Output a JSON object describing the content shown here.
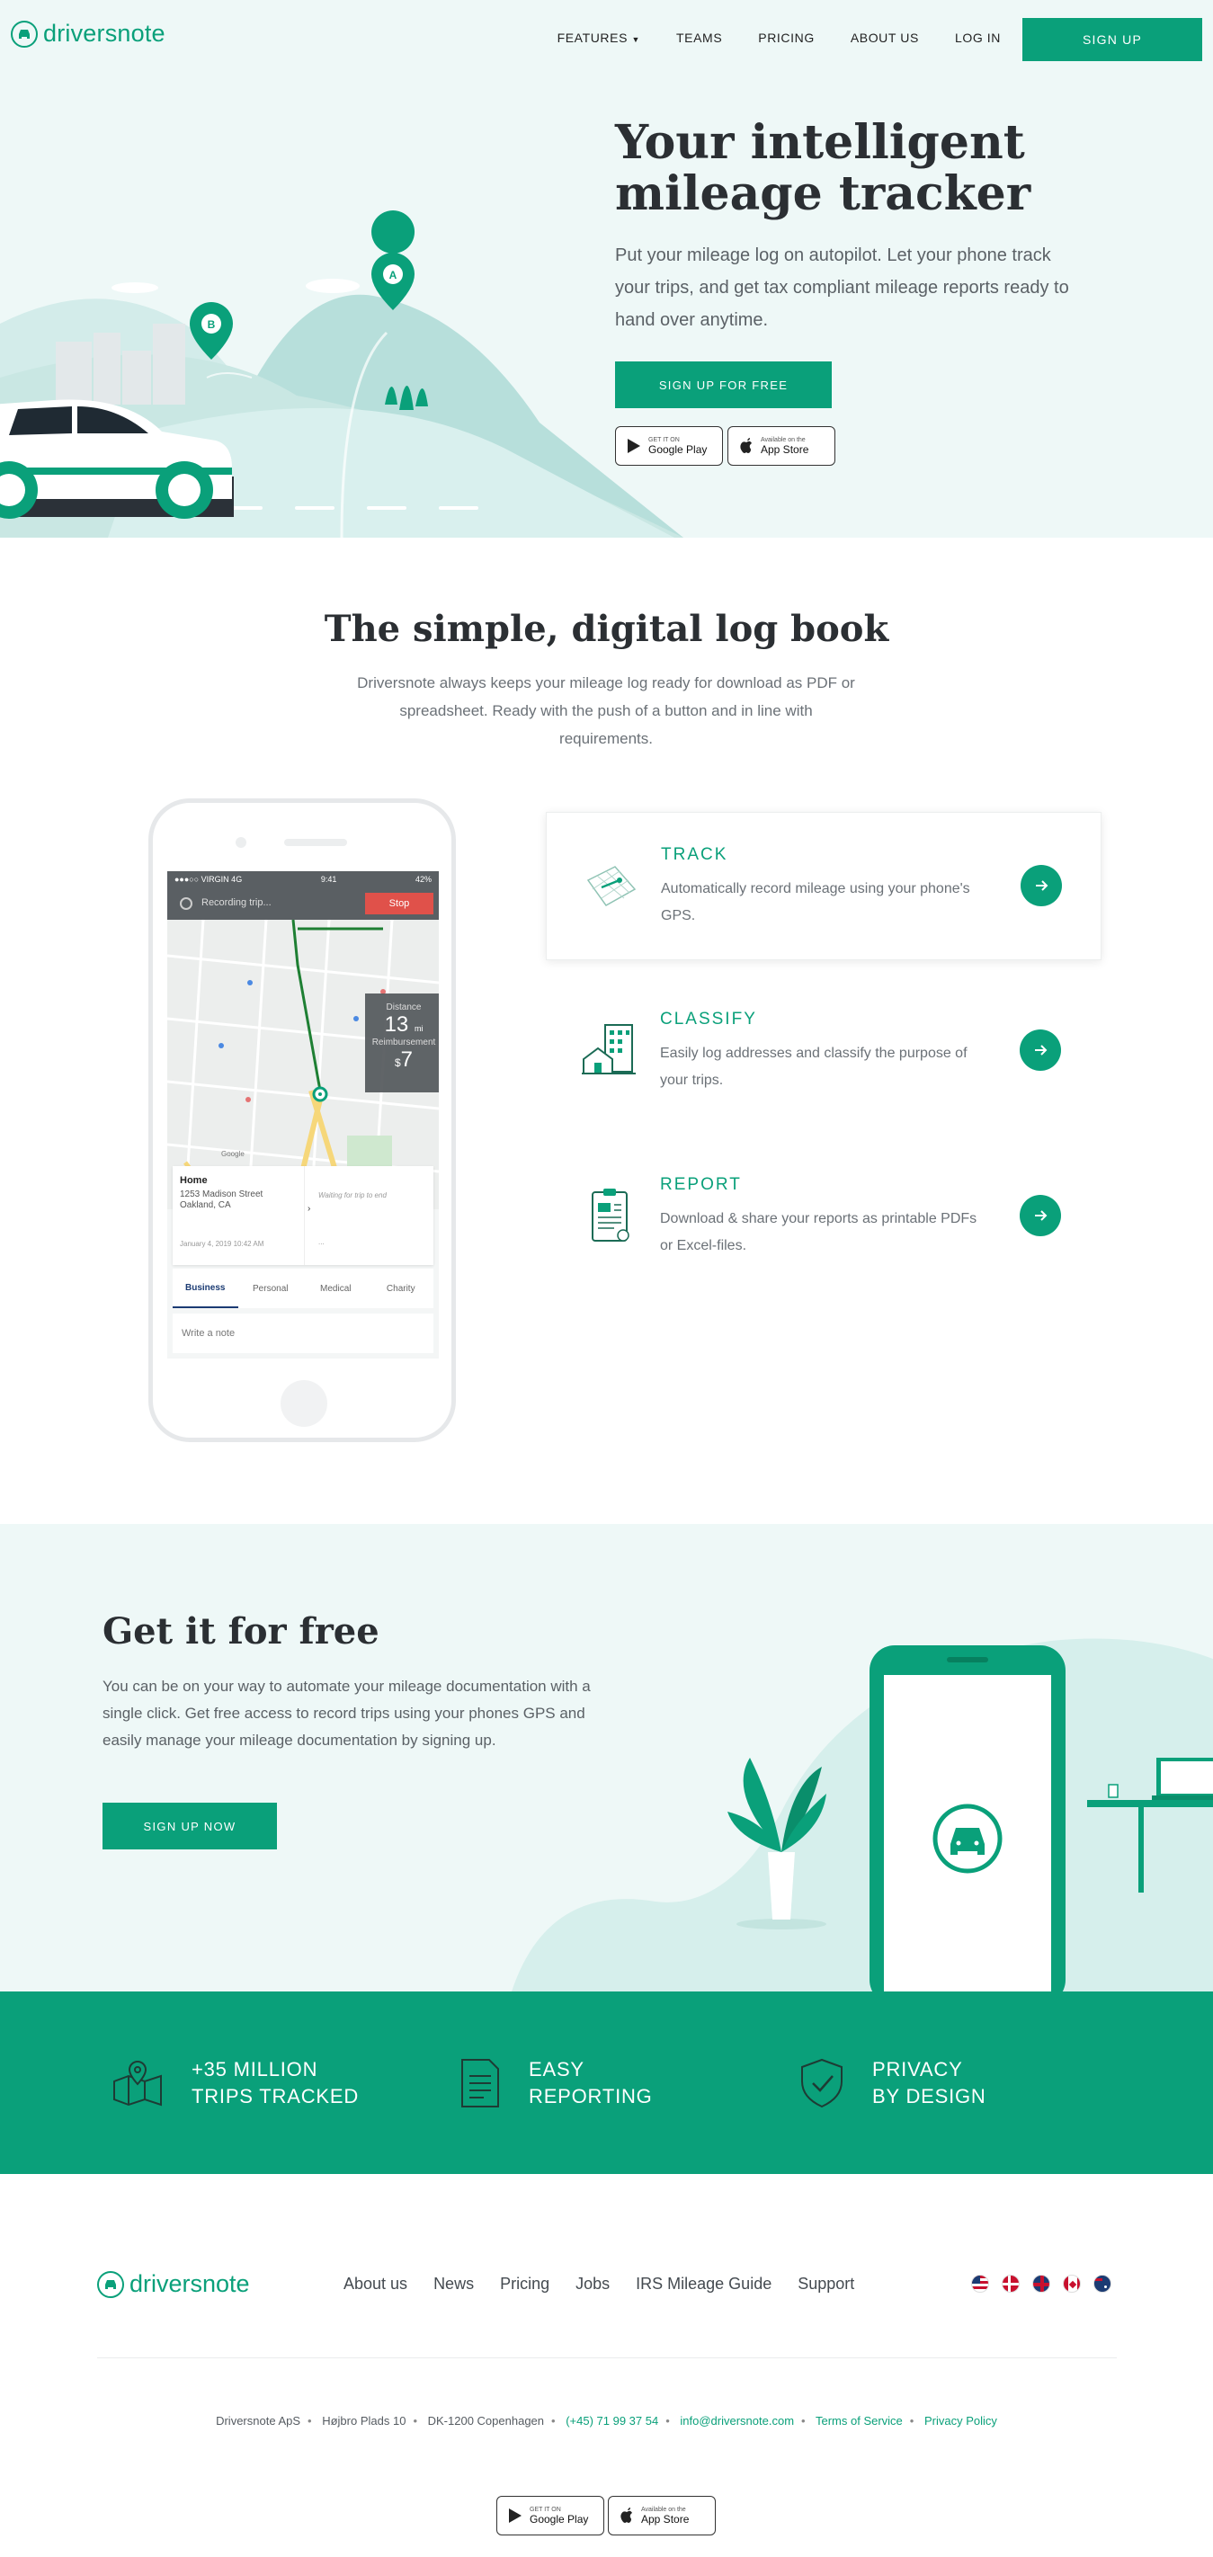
{
  "brand": {
    "name": "driversnote"
  },
  "nav": {
    "features": "FEATURES",
    "teams": "TEAMS",
    "pricing": "PRICING",
    "about": "ABOUT US",
    "login": "LOG IN",
    "signup": "SIGN UP"
  },
  "hero": {
    "title_line1": "Your intelligent",
    "title_line2": "mileage tracker",
    "subtitle": "Put your mileage log on autopilot. Let your phone track your trips, and get tax compliant mileage reports ready to hand over anytime.",
    "cta": "SIGN UP FOR FREE",
    "pin_a": "A",
    "pin_b": "B"
  },
  "stores": {
    "google_small": "GET IT ON",
    "google_big": "Google Play",
    "apple_small": "Available on the",
    "apple_big": "App Store"
  },
  "logbook": {
    "title": "The simple, digital log book",
    "subtitle": "Driversnote always keeps your mileage log ready for download as PDF or spreadsheet. Ready with the push of a button and in line with requirements."
  },
  "phone_app": {
    "carrier": "●●●○○ VIRGIN 4G",
    "time": "9:41",
    "battery": "42%",
    "recording": "Recording trip...",
    "stop": "Stop",
    "distance_label": "Distance",
    "distance_value": "13",
    "distance_unit": "mi",
    "reimb_label": "Reimbursement",
    "reimb_value": "7",
    "reimb_prefix": "$",
    "from_title": "Home",
    "from_addr1": "1253 Madison Street",
    "from_addr2": "Oakland, CA",
    "from_date": "January 4, 2019 10:42 AM",
    "to_waiting": "Waiting for trip to end",
    "to_dots": "...",
    "map_credit": "Google",
    "tabs": [
      "Business",
      "Personal",
      "Medical",
      "Charity"
    ],
    "note": "Write a note"
  },
  "features": [
    {
      "title": "TRACK",
      "text": "Automatically record mileage using your phone's GPS."
    },
    {
      "title": "CLASSIFY",
      "text": "Easily log addresses and classify the purpose of your trips."
    },
    {
      "title": "REPORT",
      "text": "Download & share your reports as printable PDFs or Excel-files."
    }
  ],
  "free": {
    "title": "Get it for free",
    "text": "You can be on your way to automate your mileage documentation with a single click. Get free access to record trips using your phones GPS and easily manage your mileage documentation by signing up.",
    "cta": "SIGN UP NOW"
  },
  "stats": [
    {
      "line1": "+35 MILLION",
      "line2": "TRIPS TRACKED"
    },
    {
      "line1": "EASY",
      "line2": "REPORTING"
    },
    {
      "line1": "PRIVACY",
      "line2": "BY DESIGN"
    }
  ],
  "footer": {
    "links": [
      "About us",
      "News",
      "Pricing",
      "Jobs",
      "IRS Mileage Guide",
      "Support"
    ],
    "company": "Driversnote ApS",
    "street": "Højbro Plads 10",
    "city": "DK-1200 Copenhagen",
    "phone": "(+45) 71 99 37 54",
    "email": "info@driversnote.com",
    "terms": "Terms of Service",
    "privacy": "Privacy Policy"
  },
  "colors": {
    "brand": "#0aa07a",
    "hero_bg": "#eef8f7",
    "stop_red": "#e0514a"
  }
}
